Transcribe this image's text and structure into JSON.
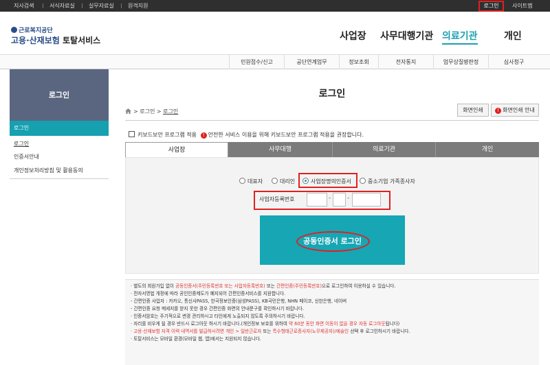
{
  "topbar": {
    "links": [
      "지사검색",
      "서식자료실",
      "실무자료실",
      "원격지원"
    ],
    "login": "로그인",
    "sitemap": "사이트맵"
  },
  "header": {
    "logo_top": "근로복지공단",
    "logo_main": "고용·산재보험",
    "logo_main_dark": "토탈서비스",
    "gnav": [
      "사업장",
      "사무대행기관",
      "의료기관",
      "개인"
    ]
  },
  "subnav": [
    "민원접수/신고",
    "공단연계업무",
    "정보조회",
    "전자통지",
    "업무상질병판정",
    "심사청구"
  ],
  "sidebar": {
    "title": "로그인",
    "active": "로그인",
    "items": [
      "로그인",
      "인증서안내",
      "개인정보처리방침 및 활용동의"
    ]
  },
  "main": {
    "title": "로그인",
    "breadcrumb": {
      "sep": ">",
      "item1": "로그인",
      "item2": "로그인"
    },
    "print_button": "화면인쇄",
    "print_guide_button": "화면인쇄 안내",
    "alert_symbol": "!",
    "keyboard_security_label": "키보드보안 프로그램 적용",
    "keyboard_security_note": "안전한 서비스 이용을 위해 키보드보안 프로그램 적용을 권장합니다.",
    "tabs": [
      "사업장",
      "사무대행",
      "의료기관",
      "개인"
    ],
    "radios": [
      "대표자",
      "대리인",
      "사업장명의인증서",
      "중소기업 가족종사자"
    ],
    "selected_radio": "사업장명의인증서",
    "biz_no_label": "사업자등록번호",
    "biz_dash": "-",
    "cert_login_button": "공동인증서 로그인"
  },
  "notice": [
    [
      {
        "t": "· 별도의 회원가입 없이 "
      },
      {
        "t": "공동인증서(주민등록번호 또는 사업자등록번호)",
        "red": true
      },
      {
        "t": " 또는 "
      },
      {
        "t": "간편인증(주민등록번호)",
        "red": true
      },
      {
        "t": "으로 로그인하여 이용하실 수 있습니다."
      }
    ],
    [
      {
        "t": "· 전자서명법 개정에 따라 공인인증제도가 폐지되어 간편인증서비스를 지원합니다."
      }
    ],
    [
      {
        "t": "  - 간편인증 사업자 : 카카오, 통신사PASS, 한국정보인증(삼성PASS), KB국민은행, NHN 페이코, 신한은행, 네이버"
      }
    ],
    [
      {
        "t": "  - 간편인증 요청 메세지를 받지 못한 경우 간편인증 화면의 안내문구를 확인하시기 바랍니다."
      }
    ],
    [
      {
        "t": "· 인증서암호는 주기적으로 변경 관리하시고 타인에게 노출되지 않도록 주의하시기 바랍니다."
      }
    ],
    [
      {
        "t": "· 자리를 비우게 될 경우 반드시 로그아웃 하시기 바랍니다.(개인정보 보호를 위하여 "
      },
      {
        "t": "약 60분 동안 화면 이동이 없을 경우 자동 로그아웃",
        "red": true
      },
      {
        "t": "됩니다)"
      }
    ],
    [
      {
        "t": "· 고용·산재보험 자격 이력 내역서를 발급하시려면 ",
        "red": true
      },
      {
        "t": "개인 > 일반근로자",
        "red": true
      },
      {
        "t": " 또는 "
      },
      {
        "t": "특수형태근로종사자(노무제공자)/예술인",
        "red": true
      },
      {
        "t": " 선택 후 로그인하시기 바랍니다."
      }
    ],
    [
      {
        "t": "· 토탈서비스는 모바일 환경(모바일 웹, 앱)에서는 지원되지 않습니다."
      }
    ]
  ],
  "colors": {
    "accent": "#16a0b0",
    "highlight": "#e02020",
    "sidebar": "#5a6680"
  }
}
